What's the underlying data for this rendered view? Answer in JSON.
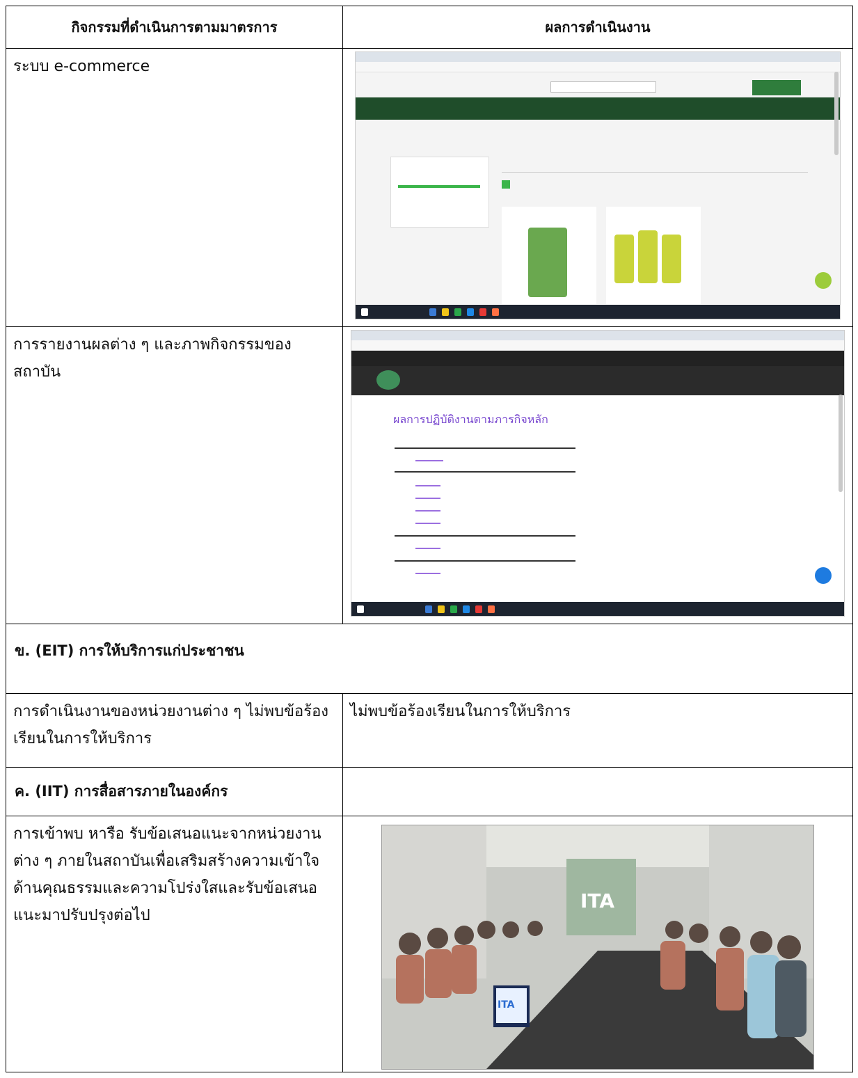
{
  "table": {
    "header": {
      "col1": "กิจกรรมที่ดำเนินการตามมาตรการ",
      "col2": "ผลการดำเนินงาน"
    },
    "rows": [
      {
        "activity": "ระบบ e-commerce",
        "result_type": "screenshot"
      },
      {
        "activity": "การรายงานผลต่าง ๆ และภาพกิจกรรมของสถาบัน",
        "result_type": "screenshot"
      }
    ],
    "section_b": {
      "title": "ข. (EIT) การให้บริการแก่ประชาชน",
      "activity": "การดำเนินงานของหน่วยงานต่าง ๆ ไม่พบข้อร้องเรียนในการให้บริการ",
      "result": "ไม่พบข้อร้องเรียนในการให้บริการ"
    },
    "section_c": {
      "title": "ค. (IIT) การสื่อสารภายในองค์กร",
      "activity": "การเข้าพบ หารือ รับข้อเสนอแนะจากหน่วยงานต่าง ๆ ภายในสถาบันเพื่อเสริมสร้างความเข้าใจด้านคุณธรรมและความโปร่งใสและรับข้อเสนอแนะมาปรับปรุงต่อไป",
      "result_type": "photo"
    }
  },
  "screenshot2": {
    "heading": "ผลการปฏิบัติงานตามภารกิจหลัก"
  },
  "photo": {
    "screen_text": "ITA"
  },
  "colors": {
    "shop_green": "#1f4d2a",
    "link_purple": "#7b4bd0",
    "chat_blue": "#1e7be0"
  }
}
